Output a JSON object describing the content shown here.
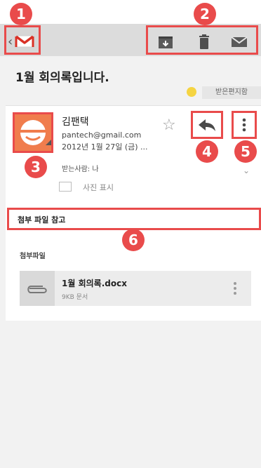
{
  "header": {
    "back_glyph": "‹",
    "logo_icon": "gmail-icon",
    "actions": [
      {
        "name": "archive",
        "icon": "archive-icon"
      },
      {
        "name": "delete",
        "icon": "trash-icon"
      },
      {
        "name": "mark-unread",
        "icon": "envelope-icon"
      }
    ]
  },
  "message": {
    "subject": "1월 회의록입니다.",
    "label": "받은편지함",
    "sender": {
      "name": "김팬택",
      "email": "pantech@gmail.com",
      "date": "2012년 1월 27일 (금) ..."
    },
    "recipient": "받는사람: 나",
    "show_images": "사진 표시",
    "body": "첨부 파일 참고"
  },
  "attachments": {
    "title": "첨부파일",
    "items": [
      {
        "name": "1월 회의록.docx",
        "meta": "9KB 문서"
      }
    ]
  },
  "callouts": [
    "1",
    "2",
    "3",
    "4",
    "5",
    "6"
  ],
  "colors": {
    "callout": "#e94b4b",
    "label_dot": "#f5d442",
    "action_bar": "#dcdcdc"
  }
}
